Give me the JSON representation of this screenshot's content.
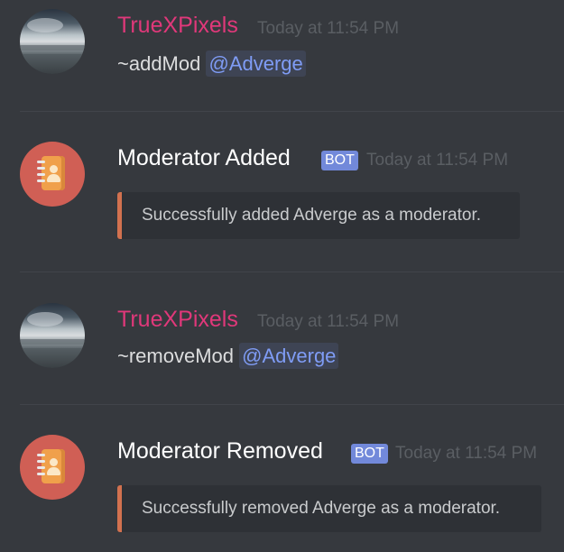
{
  "messages": [
    {
      "author": "TrueXPixels",
      "timestamp": "Today at 11:54 PM",
      "command": "~addMod",
      "mention": "@Adverge"
    },
    {
      "author": "Moderator Added",
      "badge": "BOT",
      "timestamp": "Today at 11:54 PM",
      "embed_text": "Successfully added Adverge as a moderator."
    },
    {
      "author": "TrueXPixels",
      "timestamp": "Today at 11:54 PM",
      "command": "~removeMod",
      "mention": "@Adverge"
    },
    {
      "author": "Moderator Removed",
      "badge": "BOT",
      "timestamp": "Today at 11:54 PM",
      "embed_text": "Successfully removed Adverge as a moderator."
    }
  ],
  "colors": {
    "background": "#36393e",
    "username_user": "#e0387a",
    "bot_badge": "#7289da",
    "mention": "#7f9cf5",
    "embed_border": "#d2714f"
  },
  "icons": {
    "user_avatar": "seascape-photo-avatar",
    "bot_avatar": "address-book-icon"
  }
}
